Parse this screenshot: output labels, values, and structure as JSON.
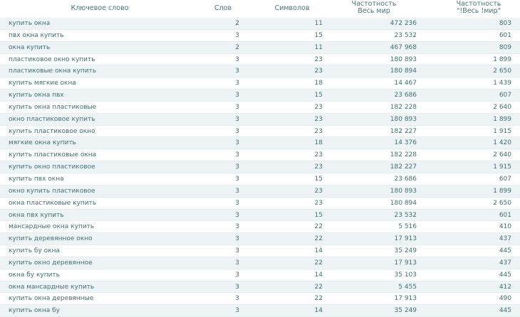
{
  "headers": {
    "keyword": "Ключевое слово",
    "words": "Слов",
    "chars": "Символов",
    "freq1_line1": "Частотность",
    "freq1_line2": "Весь мир",
    "freq2_line1": "Частотность",
    "freq2_line2": "\"!Весь !мир\""
  },
  "rows": [
    {
      "kw": "купить окна",
      "w": "2",
      "s": "11",
      "f1": "472 236",
      "f2": "803"
    },
    {
      "kw": "пвх окна купить",
      "w": "3",
      "s": "15",
      "f1": "23 532",
      "f2": "601"
    },
    {
      "kw": "окна купить",
      "w": "2",
      "s": "11",
      "f1": "467 968",
      "f2": "809"
    },
    {
      "kw": "пластиковое окно купить",
      "w": "3",
      "s": "23",
      "f1": "180 893",
      "f2": "1 899"
    },
    {
      "kw": "пластиковые окна купить",
      "w": "3",
      "s": "23",
      "f1": "180 894",
      "f2": "2 650"
    },
    {
      "kw": "купить мягкие окна",
      "w": "3",
      "s": "18",
      "f1": "14 467",
      "f2": "1 439"
    },
    {
      "kw": "купить окна пвх",
      "w": "3",
      "s": "15",
      "f1": "23 686",
      "f2": "607"
    },
    {
      "kw": "купить окна пластиковые",
      "w": "3",
      "s": "23",
      "f1": "182 228",
      "f2": "2 640"
    },
    {
      "kw": "окно пластиковое купить",
      "w": "3",
      "s": "23",
      "f1": "180 893",
      "f2": "1 899"
    },
    {
      "kw": "купить пластиковое окно",
      "w": "3",
      "s": "23",
      "f1": "182 227",
      "f2": "1 915"
    },
    {
      "kw": "мягкие окна купить",
      "w": "3",
      "s": "18",
      "f1": "14 376",
      "f2": "1 420"
    },
    {
      "kw": "купить пластиковые окна",
      "w": "3",
      "s": "23",
      "f1": "182 228",
      "f2": "2 640"
    },
    {
      "kw": "купить окно пластиковое",
      "w": "3",
      "s": "23",
      "f1": "182 227",
      "f2": "1 915"
    },
    {
      "kw": "купить пвх окна",
      "w": "3",
      "s": "15",
      "f1": "23 686",
      "f2": "607"
    },
    {
      "kw": "окно купить пластиковое",
      "w": "3",
      "s": "23",
      "f1": "180 893",
      "f2": "1 899"
    },
    {
      "kw": "окна пластиковые купить",
      "w": "3",
      "s": "23",
      "f1": "180 894",
      "f2": "2 650"
    },
    {
      "kw": "окна пвх купить",
      "w": "3",
      "s": "15",
      "f1": "23 532",
      "f2": "601"
    },
    {
      "kw": "мансардные окна купить",
      "w": "3",
      "s": "22",
      "f1": "5 516",
      "f2": "410"
    },
    {
      "kw": "купить деревянное окно",
      "w": "3",
      "s": "22",
      "f1": "17 913",
      "f2": "437"
    },
    {
      "kw": "купить бу окна",
      "w": "3",
      "s": "14",
      "f1": "35 249",
      "f2": "445"
    },
    {
      "kw": "купить окно деревянное",
      "w": "3",
      "s": "22",
      "f1": "17 913",
      "f2": "437"
    },
    {
      "kw": "окна бу купить",
      "w": "3",
      "s": "14",
      "f1": "35 103",
      "f2": "445"
    },
    {
      "kw": "окна мансардные купить",
      "w": "3",
      "s": "22",
      "f1": "5 455",
      "f2": "412"
    },
    {
      "kw": "купить окна деревянные",
      "w": "3",
      "s": "22",
      "f1": "17 913",
      "f2": "490"
    },
    {
      "kw": "купить окна бу",
      "w": "3",
      "s": "14",
      "f1": "35 249",
      "f2": "445"
    }
  ]
}
